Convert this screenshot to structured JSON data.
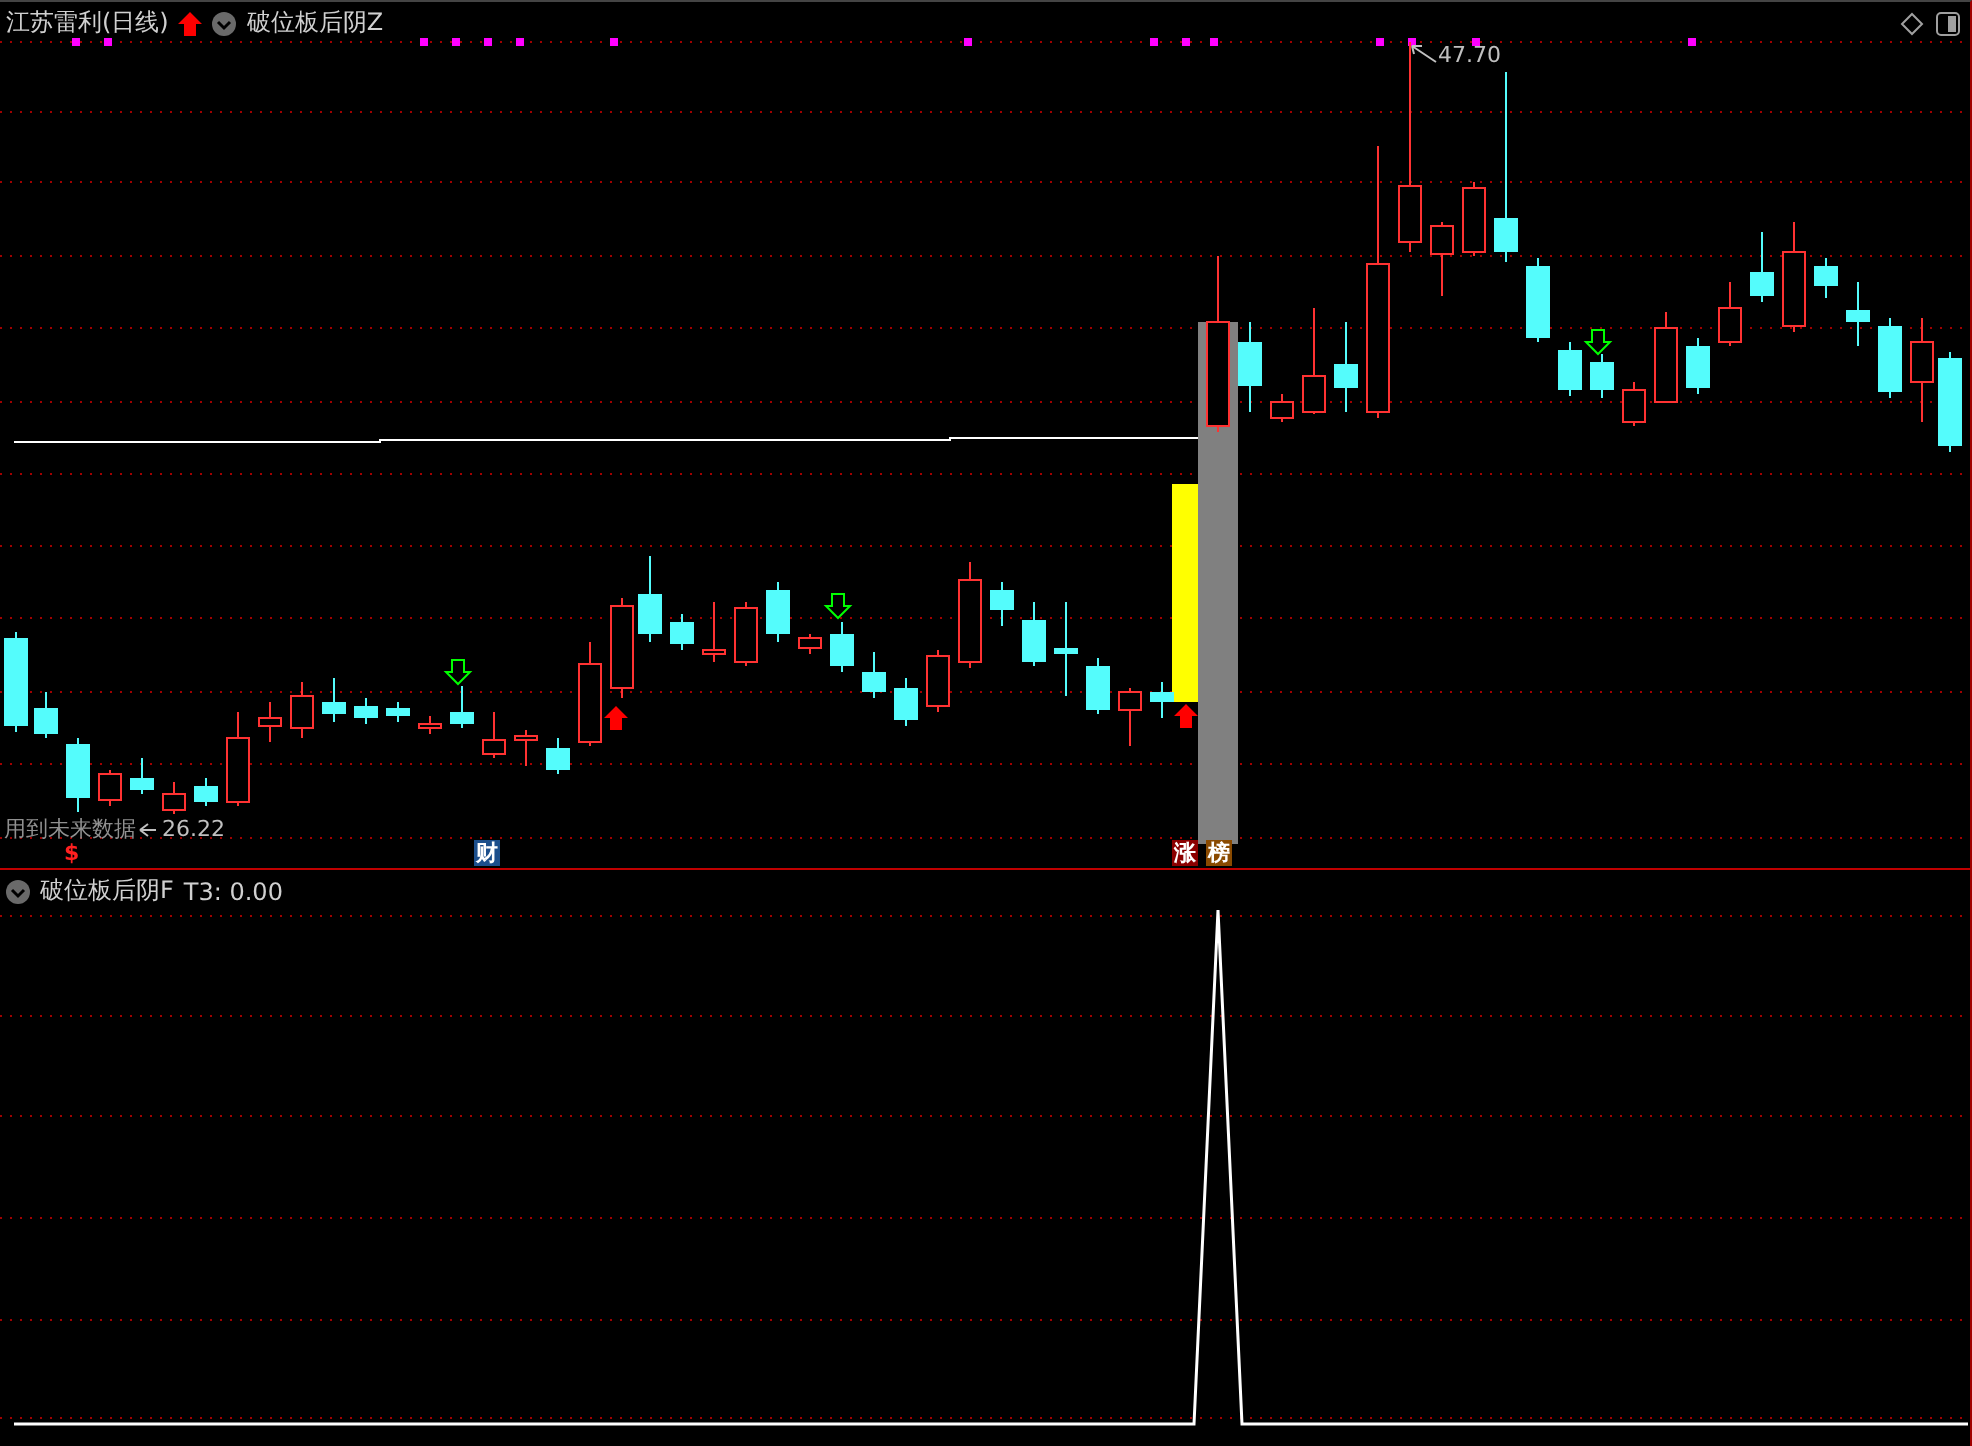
{
  "header": {
    "title": "江苏雷利(日线)",
    "indicator": "破位板后阴Z"
  },
  "price_labels": {
    "high": "47.70",
    "low": "26.22"
  },
  "warning": "用到未来数据",
  "markers": [
    {
      "kind": "dollar",
      "text": "$"
    },
    {
      "kind": "finance",
      "text": "财"
    },
    {
      "kind": "limit_up",
      "text": "涨"
    },
    {
      "kind": "ranking",
      "text": "榜"
    }
  ],
  "lower_pane": {
    "indicator": "破位板后阴F",
    "reading": "T3: 0.00"
  }
}
